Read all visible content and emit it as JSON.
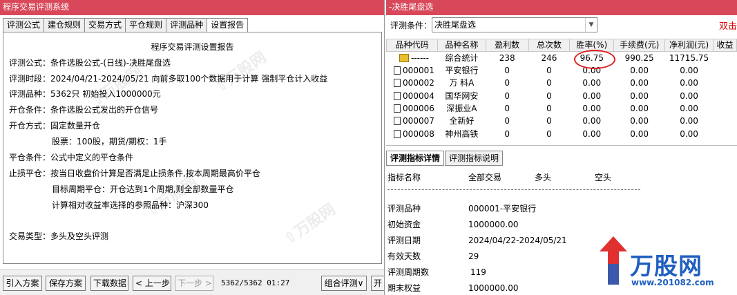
{
  "left": {
    "title": "程序交易评测系统",
    "tabs": [
      "评测公式",
      "建仓规则",
      "交易方式",
      "平仓规则",
      "评测品种",
      "设置报告"
    ],
    "active_tab_index": 5,
    "report_title": "程序交易评测设置报告",
    "report_lines": [
      "评测公式：条件选股公式-(日线)-决胜尾盘选",
      "评测时段：2024/04/21-2024/05/21 向前多取100个数据用于计算 强制平仓计入收益",
      "评测品种：5362只 初始投入1000000元",
      "开仓条件：条件选股公式发出的开仓信号",
      "开仓方式：固定数量开仓",
      "股票：100股，期货/期权：1手",
      "平仓条件：公式中定义的平仓条件",
      "止损平仓：按当日收盘价计算是否满足止损条件,按本周期最高价平仓",
      "目标周期平仓：开仓达到1个周期,则全部数量平仓",
      "计算相对收益率选择的参照品种：沪深300",
      "交易类型：多头及空头评测"
    ],
    "buttons": {
      "import": "引入方案",
      "save": "保存方案",
      "download": "下载数据",
      "prev": "< 上一步",
      "next": "下一步 >",
      "combo": "组合评测∨",
      "last": "开"
    },
    "status": "5362/5362 01:27"
  },
  "right": {
    "title": "-决胜尾盘选",
    "condition_label": "评测条件：",
    "condition_value": "决胜尾盘选",
    "red_text": "双击",
    "columns": [
      "品种代码",
      "品种名称",
      "盈利数",
      "总次数",
      "胜率(%)",
      "手续费(元)",
      "净利润(元)",
      "收益"
    ],
    "rows": [
      {
        "code": "------",
        "name": "综合统计",
        "profit": "238",
        "total": "246",
        "rate": "96.75",
        "fee": "990.25",
        "net": "11715.75"
      },
      {
        "code": "000001",
        "name": "平安银行",
        "profit": "0",
        "total": "0",
        "rate": "0.00",
        "fee": "0.00",
        "net": "0.00"
      },
      {
        "code": "000002",
        "name": "万 科A",
        "profit": "0",
        "total": "0",
        "rate": "0.00",
        "fee": "0.00",
        "net": "0.00"
      },
      {
        "code": "000004",
        "name": "国华网安",
        "profit": "0",
        "total": "0",
        "rate": "0.00",
        "fee": "0.00",
        "net": "0.00"
      },
      {
        "code": "000006",
        "name": "深振业A",
        "profit": "0",
        "total": "0",
        "rate": "0.00",
        "fee": "0.00",
        "net": "0.00"
      },
      {
        "code": "000007",
        "name": "全新好",
        "profit": "0",
        "total": "0",
        "rate": "0.00",
        "fee": "0.00",
        "net": "0.00"
      },
      {
        "code": "000008",
        "name": "神州高铁",
        "profit": "0",
        "total": "0",
        "rate": "0.00",
        "fee": "0.00",
        "net": "0.00"
      }
    ],
    "detail_tabs": [
      "评测指标详情",
      "评测指标说明"
    ],
    "detail_header": [
      "指标名称",
      "全部交易",
      "多头",
      "空头"
    ],
    "detail_rows": [
      {
        "label": "评测品种",
        "value": "000001-平安银行"
      },
      {
        "label": "初始资金",
        "value": "1000000.00"
      },
      {
        "label": "评测日期",
        "value": "2024/04/22-2024/05/21"
      },
      {
        "label": "有效天数",
        "value": "29"
      },
      {
        "label": "评测周期数",
        "value": "119"
      },
      {
        "label": "期末权益",
        "value": "1000000.00"
      }
    ],
    "logo_text": "万股网",
    "logo_url": "www.201082.com",
    "accent_color": "#d9485a",
    "highlight_color": "#e02020"
  }
}
